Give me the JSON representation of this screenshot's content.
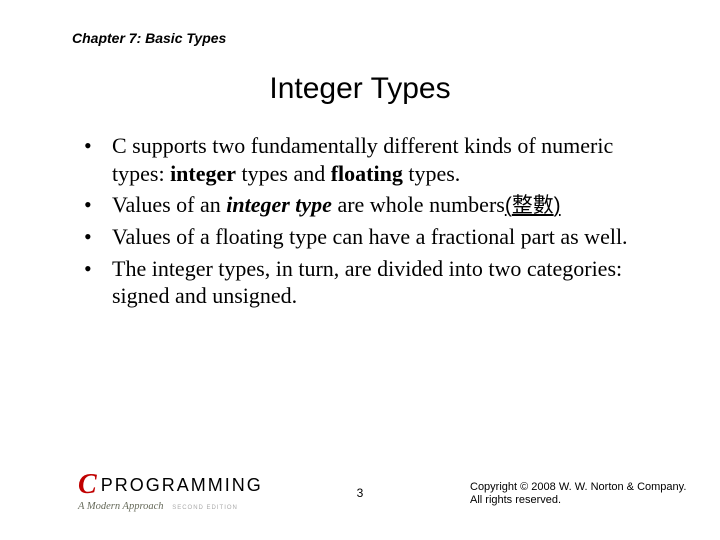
{
  "header": {
    "chapter_label": "Chapter 7: Basic Types"
  },
  "title": "Integer Types",
  "bullets": [
    {
      "pre": "C supports two fundamentally different kinds of numeric types: ",
      "bold1": "integer",
      "mid1": " types and ",
      "bold2": "floating",
      "post": " types."
    },
    {
      "pre": "Values of an ",
      "bi": "integer type",
      "post_before_paren": " are whole numbers",
      "paren_open": "(",
      "zh": "整數",
      "paren_close": ")"
    },
    {
      "full": "Values of a floating type can have a fractional part as well."
    },
    {
      "full": "The integer types, in turn, are divided into two categories: signed and unsigned."
    }
  ],
  "footer": {
    "logo": {
      "c": "C",
      "programming": "PROGRAMMING",
      "subtitle": "A Modern Approach",
      "edition": "SECOND EDITION"
    },
    "page_number": "3",
    "copyright_l1": "Copyright © 2008 W. W. Norton & Company.",
    "copyright_l2": "All rights reserved."
  }
}
